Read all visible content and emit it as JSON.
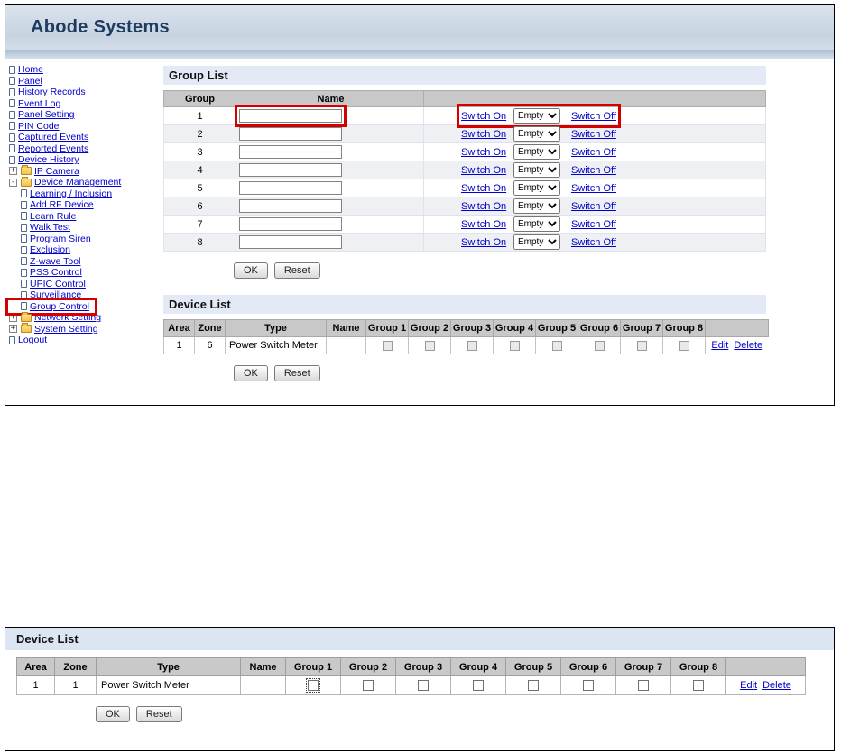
{
  "shot1": {
    "brand": "Abode Systems",
    "icons": {
      "plus": "+",
      "minus": "-"
    },
    "nav": [
      {
        "label": "Home"
      },
      {
        "label": "Panel"
      },
      {
        "label": "History Records"
      },
      {
        "label": "Event Log"
      },
      {
        "label": "Panel Setting"
      },
      {
        "label": "PIN Code"
      },
      {
        "label": "Captured Events"
      },
      {
        "label": "Reported Events"
      },
      {
        "label": "Device History"
      },
      {
        "label": "IP Camera"
      },
      {
        "label": "Device Management"
      },
      {
        "label": "Learning / Inclusion"
      },
      {
        "label": "Add RF Device"
      },
      {
        "label": "Learn Rule"
      },
      {
        "label": "Walk Test"
      },
      {
        "label": "Program Siren"
      },
      {
        "label": "Exclusion"
      },
      {
        "label": "Z-wave Tool"
      },
      {
        "label": "PSS Control"
      },
      {
        "label": "UPIC Control"
      },
      {
        "label": "Surveillance"
      },
      {
        "label": "Group Control"
      },
      {
        "label": "Network Setting"
      },
      {
        "label": "System Setting"
      },
      {
        "label": "Logout"
      }
    ],
    "group_list": {
      "title": "Group List",
      "col_group": "Group",
      "col_name": "Name",
      "switch_on": "Switch On",
      "switch_off": "Switch Off",
      "select_value": "Empty",
      "ok": "OK",
      "reset": "Reset",
      "rows": [
        {
          "group": "1",
          "name": ""
        },
        {
          "group": "2",
          "name": ""
        },
        {
          "group": "3",
          "name": ""
        },
        {
          "group": "4",
          "name": ""
        },
        {
          "group": "5",
          "name": ""
        },
        {
          "group": "6",
          "name": ""
        },
        {
          "group": "7",
          "name": ""
        },
        {
          "group": "8",
          "name": ""
        }
      ]
    },
    "device_list": {
      "title": "Device List",
      "cols": [
        "Area",
        "Zone",
        "Type",
        "Name",
        "Group 1",
        "Group 2",
        "Group 3",
        "Group 4",
        "Group 5",
        "Group 6",
        "Group 7",
        "Group 8"
      ],
      "row": {
        "area": "1",
        "zone": "6",
        "type": "Power Switch Meter",
        "name": "",
        "groups_checked": [
          false,
          false,
          false,
          false,
          false,
          false,
          false,
          false
        ]
      },
      "edit": "Edit",
      "delete": "Delete",
      "ok": "OK",
      "reset": "Reset"
    }
  },
  "shot2": {
    "device_list": {
      "title": "Device List",
      "cols": [
        "Area",
        "Zone",
        "Type",
        "Name",
        "Group 1",
        "Group 2",
        "Group 3",
        "Group 4",
        "Group 5",
        "Group 6",
        "Group 7",
        "Group 8"
      ],
      "row": {
        "area": "1",
        "zone": "1",
        "type": "Power Switch Meter",
        "name": "",
        "groups_checked": [
          false,
          false,
          false,
          false,
          false,
          false,
          false,
          false
        ]
      },
      "edit": "Edit",
      "delete": "Delete",
      "ok": "OK",
      "reset": "Reset"
    }
  },
  "annotations": {
    "highlight_color": "#d40000",
    "highlighted_elements": [
      "sidebar-item-group-control",
      "group-1-name-input",
      "group-1-switch-controls"
    ]
  }
}
